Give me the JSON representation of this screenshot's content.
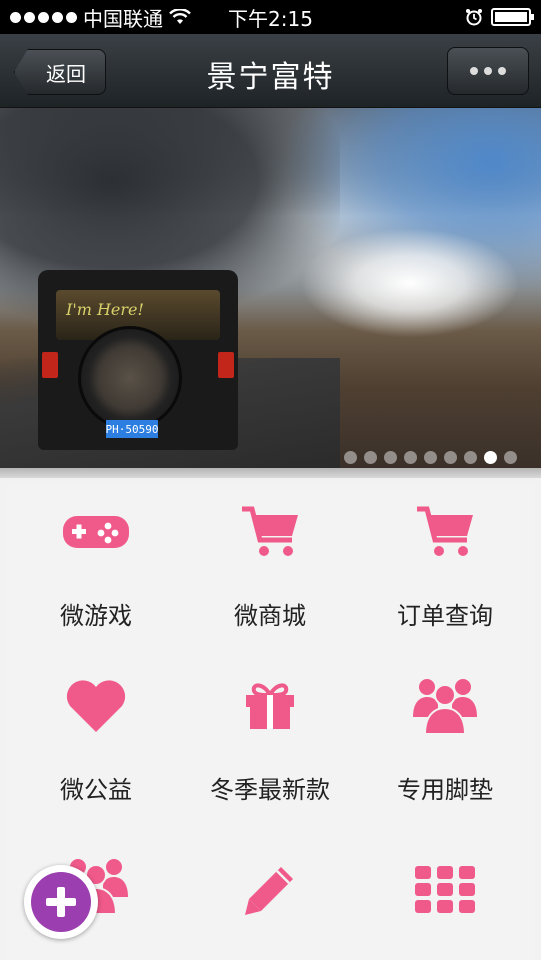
{
  "status_bar": {
    "carrier": "中国联通",
    "time": "下午2:15"
  },
  "nav": {
    "back_label": "返回",
    "title": "景宁富特"
  },
  "banner": {
    "jeep_window_text": "I'm Here!",
    "plate_text": "PH·50590",
    "page_count": 9,
    "active_page": 8
  },
  "grid": {
    "items": [
      {
        "label": "微游戏",
        "icon": "gamepad-icon"
      },
      {
        "label": "微商城",
        "icon": "cart-icon"
      },
      {
        "label": "订单查询",
        "icon": "cart-icon"
      },
      {
        "label": "微公益",
        "icon": "heart-icon"
      },
      {
        "label": "冬季最新款",
        "icon": "gift-icon"
      },
      {
        "label": "专用脚垫",
        "icon": "people-icon"
      },
      {
        "label": "",
        "icon": "people-icon"
      },
      {
        "label": "",
        "icon": "pencil-icon"
      },
      {
        "label": "",
        "icon": "grid-icon"
      }
    ]
  },
  "colors": {
    "accent": "#f05a8a",
    "fab": "#9b3fb0"
  }
}
